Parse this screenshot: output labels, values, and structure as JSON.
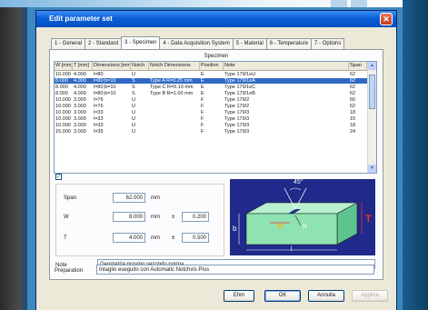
{
  "dialog": {
    "title": "Edit parameter set",
    "close_glyph": "✕"
  },
  "tabs": [
    {
      "label": "1 - General"
    },
    {
      "label": "2 - Standard"
    },
    {
      "label": "3 - Specimen"
    },
    {
      "label": "4 - Data Acquisition System"
    },
    {
      "label": "5 - Material"
    },
    {
      "label": "6 - Temperature"
    },
    {
      "label": "7 - Options"
    }
  ],
  "active_tab_index": 2,
  "specimen": {
    "group_title": "Specimen",
    "columns": [
      "W [mm]",
      "T [mm]",
      "Dimensions [mm]",
      "Notch",
      "Notch Dimensions",
      "Position",
      "Note",
      "Span"
    ],
    "rows": [
      [
        "10.000",
        "4.000",
        "l=80",
        "U",
        "",
        "E",
        "Type 179/1eU",
        "62"
      ],
      [
        "8.000",
        "4.000",
        "l=80;b=10",
        "S",
        "Type A R=0.25 mm",
        "E",
        "Type 179/1eA",
        "62"
      ],
      [
        "8.000",
        "4.000",
        "l=80;b=10",
        "S",
        "Type C R=0.10 mm",
        "E",
        "Type 179/1eC",
        "62"
      ],
      [
        "8.000",
        "4.000",
        "l=80;b=10",
        "S",
        "Type B R=1.00 mm",
        "E",
        "Type 179/1eB",
        "62"
      ],
      [
        "10.000",
        "3.000",
        "l=76",
        "U",
        "",
        "F",
        "Type 179/2",
        "60"
      ],
      [
        "10.000",
        "3.000",
        "l=76",
        "U",
        "",
        "F",
        "Type 179/2",
        "62"
      ],
      [
        "10.000",
        "3.000",
        "l=33",
        "U",
        "",
        "F",
        "Type 179/3",
        "18"
      ],
      [
        "10.000",
        "3.000",
        "l=33",
        "U",
        "",
        "F",
        "Type 179/3",
        "15"
      ],
      [
        "10.000",
        "3.000",
        "l=33",
        "U",
        "",
        "F",
        "Type 179/3",
        "18"
      ],
      [
        "15.000",
        "3.000",
        "l=35",
        "U",
        "",
        "F",
        "Type 179/3",
        "24"
      ]
    ],
    "selected_row_index": 1,
    "checkbox_checked": true
  },
  "form": {
    "span_label": "Span",
    "span_value": "62.000",
    "span_unit": "mm",
    "w_label": "W",
    "w_value": "8.000",
    "w_unit": "mm",
    "w_tol_sign": "±",
    "w_tol": "0.200",
    "t_label": "T",
    "t_value": "4.000",
    "t_unit": "mm",
    "t_tol_sign": "±",
    "t_tol": "0.500"
  },
  "diagram": {
    "angle_label": "45°",
    "b_label": "b",
    "w_label": "W",
    "r_label": "R",
    "t_label": "T",
    "l_label": "l"
  },
  "note": {
    "label": "Note",
    "value": "Geometria provino secondo norma"
  },
  "preparation": {
    "label": "Preparation",
    "value": "Intaglio eseguito con Automatic Notchvis Plus"
  },
  "buttons": {
    "help": "Ehm",
    "ok": "OK",
    "cancel": "Annulla",
    "apply": "Applica"
  },
  "colors": {
    "titlebar": "#0a5fd8",
    "selection": "#316ac5",
    "diagram_bg": "#1f2a8a",
    "specimen_green": "#8fe3b2",
    "accent_red": "#ff2a2a"
  }
}
